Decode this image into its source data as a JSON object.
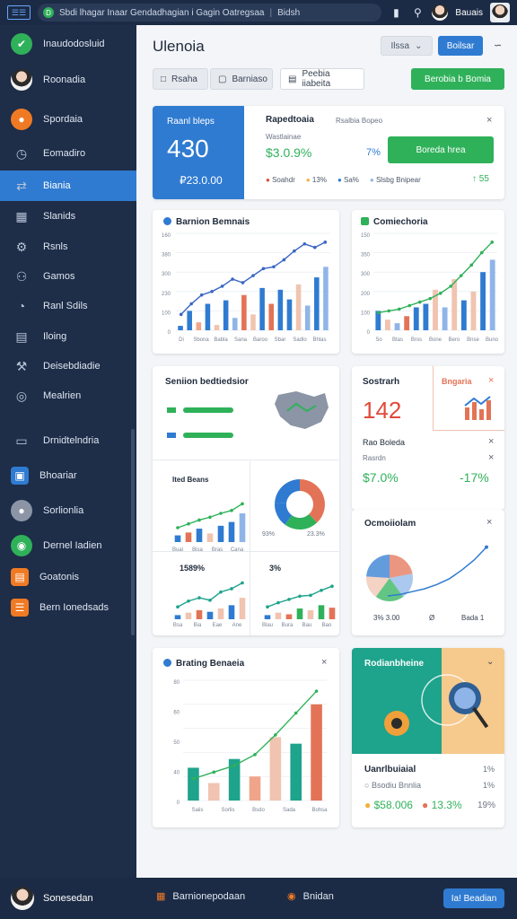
{
  "topbar": {
    "logo": "☰☰",
    "url_badge": "D",
    "url_text": "Sbdi lhagar Inaar Gendadhagian i Gagin Oatregsaa",
    "url_tail": "Bidsh",
    "user_name": "Bauais"
  },
  "sidebar": {
    "items": [
      {
        "label": "Inaudodosluid",
        "icon": "check-icon",
        "color": "#2fb15a",
        "glyph": "✔"
      },
      {
        "label": "Roonadia",
        "icon": "avatar-icon",
        "color": "#f2f2f2",
        "glyph": "●"
      },
      {
        "label": "Spordaia",
        "icon": "circle-icon",
        "color": "#f07a24",
        "glyph": "●"
      },
      {
        "label": "Eomadiro",
        "icon": "clock-icon",
        "color": "",
        "glyph": "◷"
      },
      {
        "label": "Biania",
        "icon": "share-icon",
        "color": "",
        "glyph": "⇄"
      },
      {
        "label": "Slanids",
        "icon": "chart-icon",
        "color": "",
        "glyph": "▦"
      },
      {
        "label": "Rsnls",
        "icon": "gear-icon",
        "color": "",
        "glyph": "⚙"
      },
      {
        "label": "Gamos",
        "icon": "people-icon",
        "color": "",
        "glyph": "⚇"
      },
      {
        "label": "Ranl Sdils",
        "icon": "pie-icon",
        "color": "",
        "glyph": "◔"
      },
      {
        "label": "Iloing",
        "icon": "table-icon",
        "color": "",
        "glyph": "▤"
      },
      {
        "label": "Deisebdiadie",
        "icon": "wrench-icon",
        "color": "",
        "glyph": "⚒"
      },
      {
        "label": "Mealrien",
        "icon": "target-icon",
        "color": "",
        "glyph": "◎"
      },
      {
        "label": "Drnidtelndria",
        "icon": "document-icon",
        "color": "",
        "glyph": "▭"
      },
      {
        "label": "Bhoariar",
        "icon": "blue-square-icon",
        "color": "#2f7bd1",
        "glyph": "▣"
      },
      {
        "label": "Sorlionlia",
        "icon": "grey-circle-icon",
        "color": "#8b95a5",
        "glyph": "●"
      },
      {
        "label": "Dernel Iadien",
        "icon": "map-icon",
        "color": "#2fb15a",
        "glyph": "◉"
      },
      {
        "label": "Goatonis",
        "icon": "orange-square-icon",
        "color": "#f07a24",
        "glyph": "▤"
      },
      {
        "label": "Bern Ionedsads",
        "icon": "orange-list-icon",
        "color": "#f07a24",
        "glyph": "☰"
      }
    ]
  },
  "header": {
    "title": "Ulenoia",
    "dropdown_label": "Ilssa",
    "primary_button": "Boilsar",
    "tabs": [
      "Rsaha",
      "Barniaso",
      "Peebia iiabeita"
    ],
    "green_button": "Berobia b Bomia"
  },
  "summary": {
    "panel_title": "Raanl bleps",
    "big_value": "430",
    "sub_value": "₽23.0.00",
    "report_title": "Rapedtoaia",
    "report_meta": "Rsalbia Bopeo",
    "report_sub": "Wastlainae",
    "money": "$3.0.9%",
    "pct": "7%",
    "action_button": "Boreda hrea",
    "legend": [
      {
        "label": "Soahdr",
        "color": "#e04a3a"
      },
      {
        "label": "13%",
        "color": "#f0b33a"
      },
      {
        "label": "Sa%",
        "color": "#2f7bd1"
      },
      {
        "label": "Slsbg Bnipear",
        "color": "#8fb5e8"
      }
    ],
    "trend": "↑ 55"
  },
  "chart_left": {
    "title": "Barnion Bemnais",
    "y_ticks": [
      "160",
      "380",
      "300",
      "230",
      "100",
      "0"
    ],
    "x_ticks": [
      "Di",
      "Sbona",
      "Babla",
      "Sana",
      "Baroo",
      "Sbar",
      "Sadlo",
      "Bhlas"
    ],
    "chart_data": {
      "type": "bar",
      "series": [
        {
          "values": [
            5,
            22,
            9,
            30,
            6,
            34,
            14,
            40,
            18,
            48,
            30,
            46,
            35,
            52,
            28,
            60,
            72
          ],
          "colors": [
            "#2f7bd1",
            "#2f7bd1",
            "#f0a58a",
            "#2f7bd1",
            "#f0c4b0",
            "#2f7bd1",
            "#8fb5e8",
            "#e37356",
            "#f0c4b0",
            "#2f7bd1",
            "#e37356",
            "#2f7bd1",
            "#2f7bd1",
            "#f0c4b0",
            "#8fb5e8",
            "#2f7bd1",
            "#8fb5e8"
          ]
        }
      ],
      "line": [
        18,
        30,
        40,
        44,
        50,
        58,
        54,
        62,
        70,
        72,
        80,
        90,
        98,
        94,
        100
      ],
      "ylim": [
        0,
        110
      ]
    }
  },
  "chart_right": {
    "title": "Comiechoria",
    "y_ticks": [
      "150",
      "350",
      "300",
      "200",
      "100",
      "0"
    ],
    "x_ticks": [
      "So",
      "Btas",
      "Bros",
      "Bone",
      "Bero",
      "Bnse",
      "Buno"
    ],
    "chart_data": {
      "type": "bar",
      "bars": [
        22,
        12,
        8,
        16,
        26,
        30,
        46,
        26,
        58,
        34,
        44,
        66,
        80
      ],
      "colors": [
        "#2f7bd1",
        "#f0c4b0",
        "#8fb5e8",
        "#e37356",
        "#2f7bd1",
        "#2f7bd1",
        "#f0c4b0",
        "#8fb5e8",
        "#f0c4b0",
        "#2f7bd1",
        "#f0c4b0",
        "#2f7bd1",
        "#8fb5e8"
      ],
      "line": [
        20,
        22,
        24,
        28,
        32,
        36,
        42,
        50,
        62,
        74,
        88,
        100
      ],
      "ylim": [
        0,
        110
      ]
    }
  },
  "mid_card": {
    "title": "Seniion bedtiedsior",
    "sub1": {
      "title": "Ited Beans",
      "x_ticks": [
        "Buai",
        "Bisa",
        "Bras",
        "Cana"
      ],
      "chart_data": {
        "type": "bar",
        "bars": [
          14,
          20,
          28,
          18,
          34,
          42,
          60
        ],
        "colors": [
          "#2f7bd1",
          "#e37356",
          "#2f7bd1",
          "#f0c4b0",
          "#2f7bd1",
          "#2f7bd1",
          "#8fb5e8"
        ],
        "line": [
          30,
          38,
          46,
          52,
          60,
          66,
          80
        ],
        "ylim": [
          0,
          90
        ]
      }
    },
    "donut": {
      "labels": [
        "93%",
        "23.3%"
      ],
      "chart_data": {
        "type": "pie",
        "values": [
          38,
          22,
          16,
          24
        ],
        "colors": [
          "#e37356",
          "#2fb15a",
          "#2f7bd1",
          "#2f7bd1"
        ]
      }
    },
    "sub2": {
      "title": "1589%",
      "x_ticks": [
        "Bsa",
        "Bia",
        "Eae",
        "Ane"
      ],
      "chart_data": {
        "type": "bar",
        "bars": [
          10,
          16,
          22,
          18,
          26,
          34,
          52
        ],
        "colors": [
          "#2f7bd1",
          "#f0c4b0",
          "#e37356",
          "#2f7bd1",
          "#f0c4b0",
          "#2f7bd1",
          "#f0c4b0"
        ],
        "line": [
          30,
          44,
          52,
          46,
          66,
          74,
          88
        ],
        "ylim": [
          0,
          100
        ]
      }
    },
    "sub3": {
      "title": "3%",
      "x_ticks": [
        "Blau",
        "Bura",
        "Bau",
        "Bao"
      ],
      "chart_data": {
        "type": "bar",
        "bars": [
          10,
          16,
          12,
          26,
          22,
          34,
          28
        ],
        "colors": [
          "#2f7bd1",
          "#f0c4b0",
          "#e37356",
          "#2fb15a",
          "#f0c4b0",
          "#2fb15a",
          "#e37356"
        ],
        "line": [
          30,
          40,
          48,
          56,
          58,
          70,
          80
        ],
        "ylim": [
          0,
          100
        ]
      }
    }
  },
  "stat_card": {
    "title": "Sostrarh",
    "value": "142",
    "tag": "Bngaria",
    "sub_title": "Rao Boleda",
    "sub_label": "Rasrdn",
    "money": "$7.0%",
    "delta": "-17%"
  },
  "corr_card": {
    "title": "Ocmoiiolam",
    "footer": [
      "3% 3.00",
      "Ø",
      "Bada 1"
    ],
    "chart_data": {
      "type": "pie",
      "values": [
        22,
        18,
        20,
        16,
        24
      ],
      "colors": [
        "#e37356",
        "#8fb5e8",
        "#2fb15a",
        "#f0c4b0",
        "#2f7bd1"
      ],
      "line": [
        20,
        22,
        26,
        30,
        36,
        44,
        56,
        70,
        88
      ]
    }
  },
  "bottom_chart": {
    "title": "Brating Benaeia",
    "y_ticks": [
      "80",
      "60",
      "50",
      "40",
      "0"
    ],
    "x_ticks": [
      "Saiis",
      "Sorlis",
      "Bsdo",
      "Sada",
      "Bohsa"
    ],
    "chart_data": {
      "type": "bar",
      "bars": [
        30,
        16,
        38,
        22,
        58,
        52,
        88
      ],
      "colors": [
        "#1ea38c",
        "#f0c4b0",
        "#1ea38c",
        "#f0a58a",
        "#f0c4b0",
        "#1ea38c",
        "#e37356"
      ],
      "line": [
        20,
        26,
        32,
        42,
        60,
        80,
        100
      ],
      "ylim": [
        0,
        110
      ]
    }
  },
  "promo_card": {
    "title": "Rodianbheine",
    "sub_title": "Uanrlbuiaial",
    "pct1": "1%",
    "row_label": "Bsodiu Bnnlia",
    "pct2": "1%",
    "money": "$58.006",
    "pct3": "13.3%",
    "pct4": "19%"
  },
  "bottombar": {
    "user": "Sonesedan",
    "link1": "Barnionepodaan",
    "link2": "Bnidan",
    "button": "Ia! Beadian"
  }
}
